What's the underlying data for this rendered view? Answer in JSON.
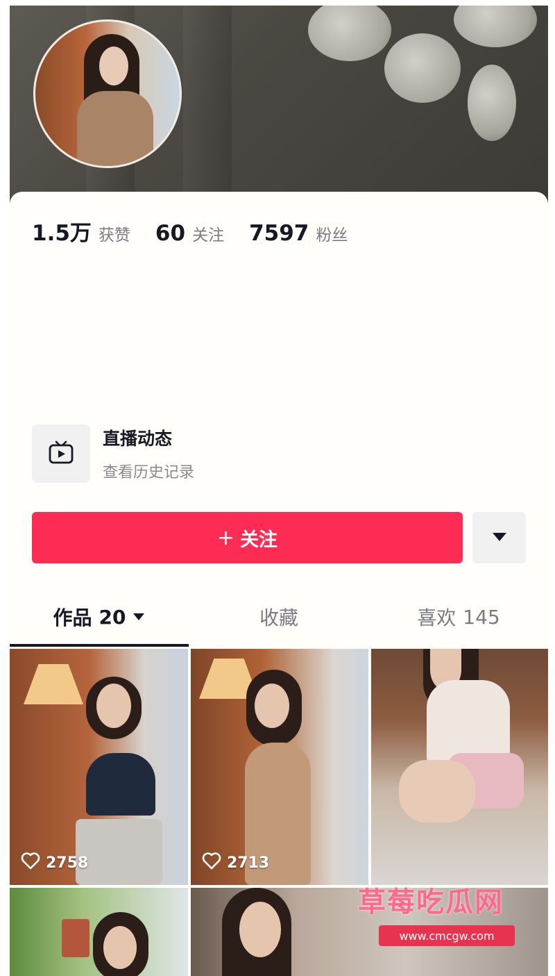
{
  "profile": {
    "stats": [
      {
        "value": "1.5万",
        "label": "获赞"
      },
      {
        "value": "60",
        "label": "关注"
      },
      {
        "value": "7597",
        "label": "粉丝"
      }
    ]
  },
  "live": {
    "title": "直播动态",
    "subtitle": "查看历史记录",
    "icon": "tv-play-icon"
  },
  "actions": {
    "follow_label": "关注",
    "follow_plus": "+",
    "more_icon": "caret-down-icon",
    "follow_color": "#fe2c55"
  },
  "tabs": {
    "works": {
      "label": "作品",
      "count": "20"
    },
    "favorites": {
      "label": "收藏"
    },
    "likes": {
      "label": "喜欢",
      "count": "145"
    }
  },
  "videos": [
    {
      "likes": "2758"
    },
    {
      "likes": "2713"
    }
  ],
  "watermark": {
    "title": "草莓吃瓜网",
    "url": "www.cmcgw.com"
  }
}
